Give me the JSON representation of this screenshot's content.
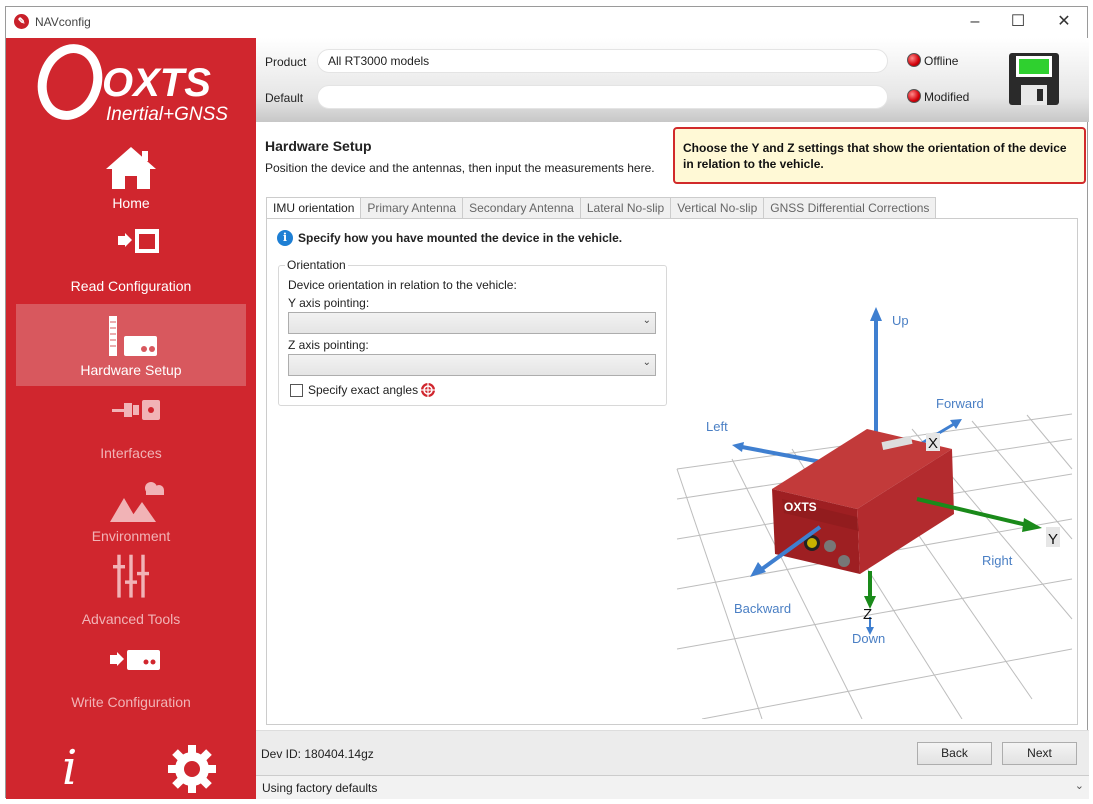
{
  "window": {
    "title": "NAVconfig"
  },
  "brand": {
    "name": "OXTS",
    "tagline": "Inertial+GNSS"
  },
  "colors": {
    "brand_red": "#d0262e",
    "active_nav": "#d8585e",
    "help_border": "#d12a2a",
    "help_bg": "#fff9d6",
    "axis_blue": "#3f7fd0",
    "axis_green": "#1a8a1a"
  },
  "nav": {
    "home": "Home",
    "read": "Read Configuration",
    "hardware": "Hardware Setup",
    "interfaces": "Interfaces",
    "environment": "Environment",
    "advanced": "Advanced Tools",
    "write": "Write Configuration"
  },
  "bottom_icons": {
    "info": "i",
    "settings_icon": "gear-icon"
  },
  "header": {
    "product_label": "Product",
    "product_value": "All RT3000 models",
    "default_label": "Default",
    "default_value": "",
    "offline": "Offline",
    "modified": "Modified"
  },
  "page": {
    "title": "Hardware Setup",
    "subtitle": "Position the device and the antennas, then input the measurements here.",
    "help": "Choose the Y and Z settings that show the orientation of the device in relation to the vehicle."
  },
  "tabs": [
    {
      "label": "IMU orientation",
      "active": true
    },
    {
      "label": "Primary Antenna",
      "active": false
    },
    {
      "label": "Secondary Antenna",
      "active": false
    },
    {
      "label": "Lateral No-slip",
      "active": false
    },
    {
      "label": "Vertical No-slip",
      "active": false
    },
    {
      "label": "GNSS Differential Corrections",
      "active": false
    }
  ],
  "imu": {
    "info": "Specify how you have mounted the device in the vehicle.",
    "group_title": "Orientation",
    "orientation_desc": "Device orientation in relation to the vehicle:",
    "y_label": "Y axis pointing:",
    "y_value": "",
    "z_label": "Z axis pointing:",
    "z_value": "",
    "exact_angles": "Specify exact angles",
    "exact_checked": false
  },
  "scene": {
    "up": "Up",
    "forward": "Forward",
    "left": "Left",
    "right": "Right",
    "backward": "Backward",
    "down": "Down",
    "x": "X",
    "y": "Y",
    "z": "Z",
    "device_brand": "OXTS"
  },
  "footer": {
    "dev_id": "Dev ID: 180404.14gz",
    "back": "Back",
    "next": "Next"
  },
  "status": {
    "text": "Using factory defaults"
  }
}
